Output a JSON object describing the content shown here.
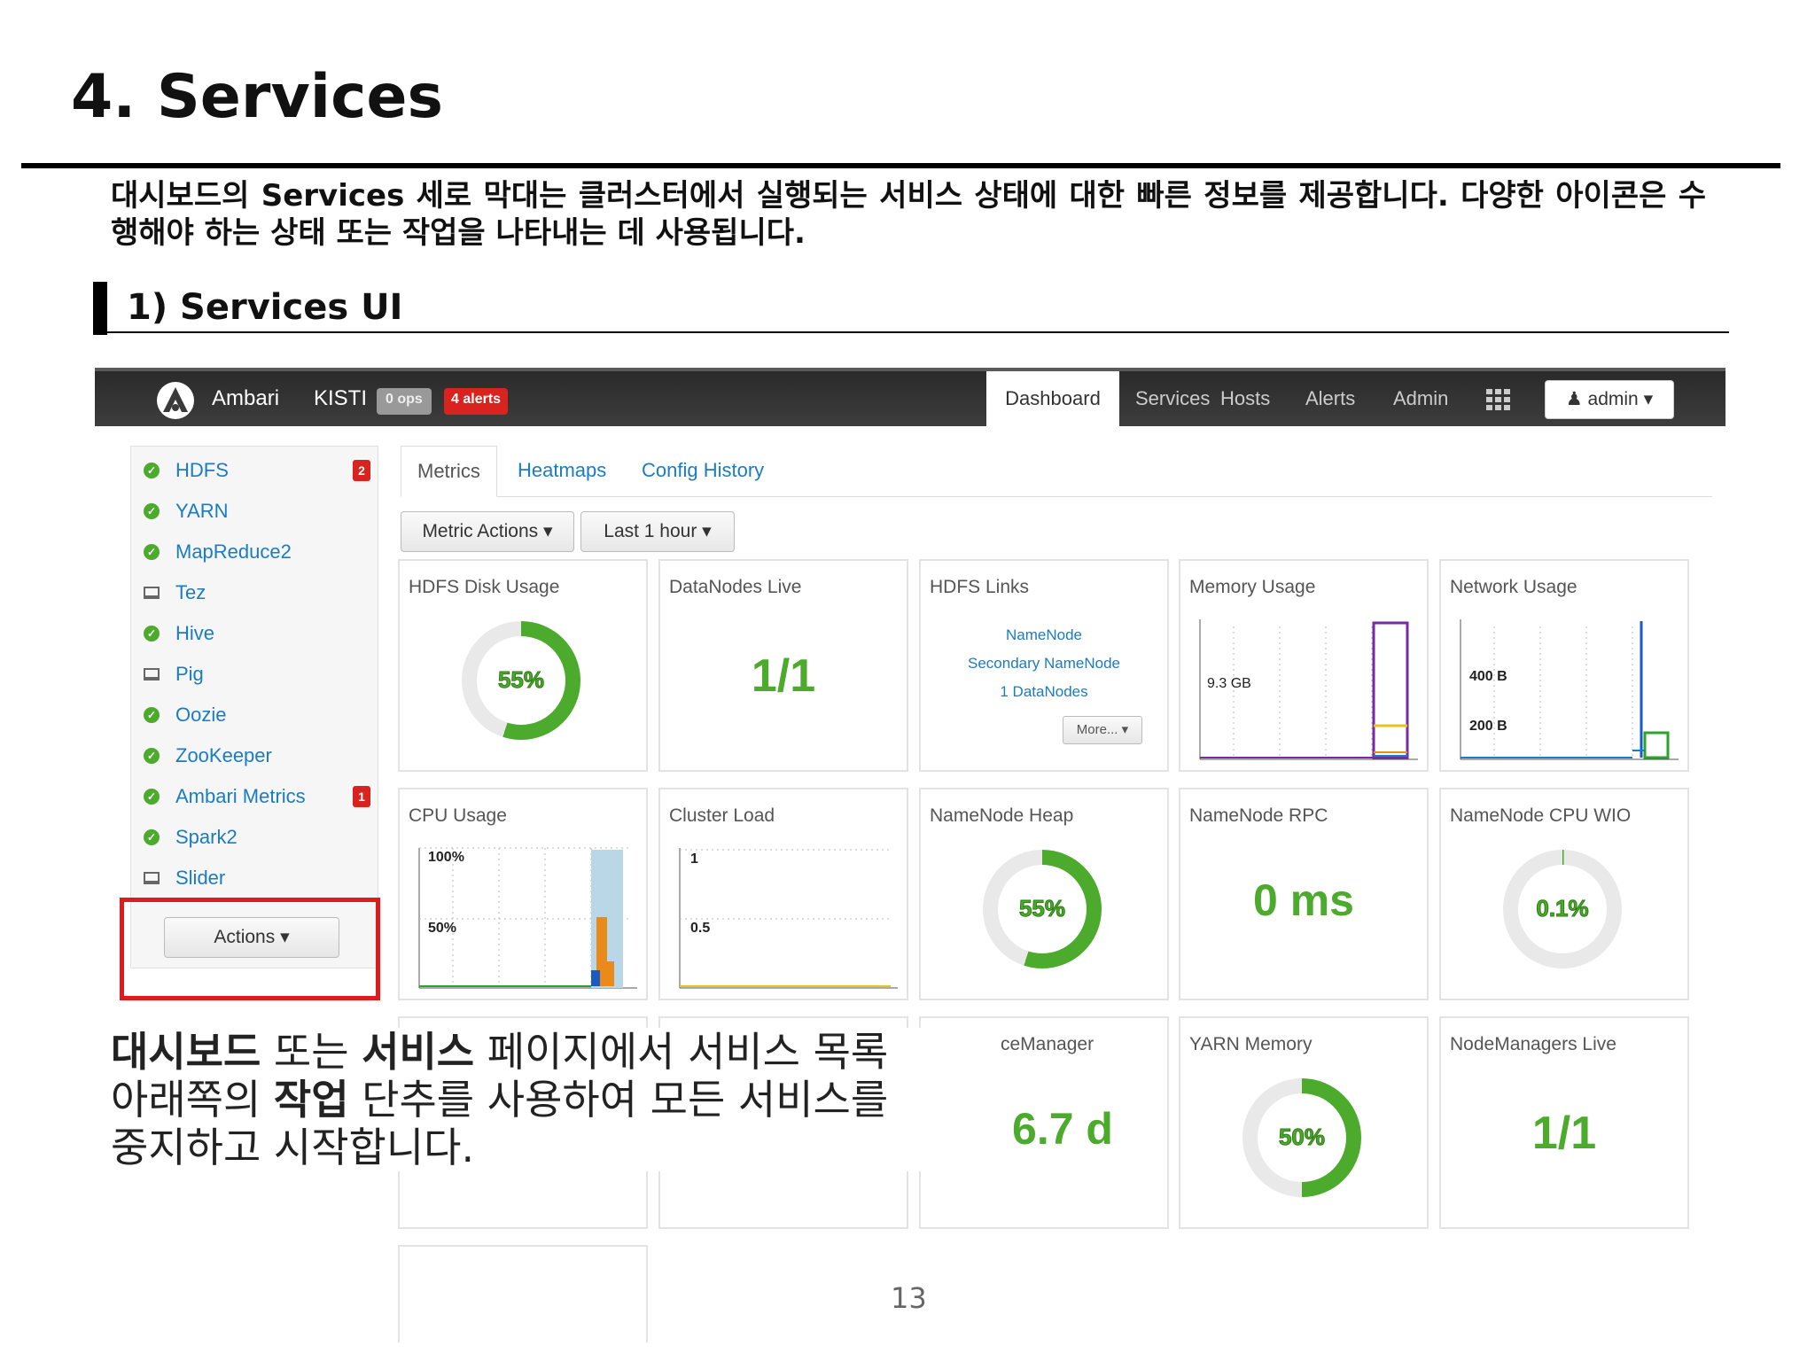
{
  "slide": {
    "title": "4. Services",
    "intro": "대시보드의 Services 세로 막대는 클러스터에서 실행되는 서비스 상태에 대한 빠른 정보를 제공합니다. 다양한 아이콘은 수행해야 하는 상태 또는 작업을 나타내는 데 사용됩니다.",
    "subtitle": "1) Services UI",
    "caption": {
      "b1": "대시보드",
      "t1": " 또는 ",
      "b2": "서비스",
      "t2": " 페이지에서 서비스 목록 아래쪽의 ",
      "b3": "작업",
      "t3": " 단추를 사용하여 모든 서비스를 중지하고 시작합니다."
    },
    "page_number": "13"
  },
  "topbar": {
    "brand": "Ambari",
    "cluster": "KISTI",
    "ops_badge": "0 ops",
    "alerts_badge": "4 alerts",
    "nav": [
      "Dashboard",
      "Services",
      "Hosts",
      "Alerts",
      "Admin"
    ],
    "grid_icon": "grid-icon",
    "user_icon": "user-icon",
    "admin": "admin"
  },
  "sidebar": {
    "services": [
      {
        "name": "HDFS",
        "icon": "check-circle-icon",
        "alerts": "2"
      },
      {
        "name": "YARN",
        "icon": "check-circle-icon"
      },
      {
        "name": "MapReduce2",
        "icon": "check-circle-icon"
      },
      {
        "name": "Tez",
        "icon": "laptop-icon"
      },
      {
        "name": "Hive",
        "icon": "check-circle-icon"
      },
      {
        "name": "Pig",
        "icon": "laptop-icon"
      },
      {
        "name": "Oozie",
        "icon": "check-circle-icon"
      },
      {
        "name": "ZooKeeper",
        "icon": "check-circle-icon"
      },
      {
        "name": "Ambari Metrics",
        "icon": "check-circle-icon",
        "alerts": "1"
      },
      {
        "name": "Spark2",
        "icon": "check-circle-icon"
      },
      {
        "name": "Slider",
        "icon": "laptop-icon"
      }
    ],
    "actions": "Actions"
  },
  "tabs": [
    "Metrics",
    "Heatmaps",
    "Config History"
  ],
  "toolbar": {
    "metric_actions": "Metric Actions",
    "time_range": "Last 1 hour"
  },
  "widgets": {
    "hdfs_disk": {
      "title": "HDFS Disk Usage",
      "value": "55%",
      "fraction": 0.55
    },
    "datanodes": {
      "title": "DataNodes Live",
      "value": "1/1"
    },
    "hdfs_links": {
      "title": "HDFS Links",
      "links": [
        "NameNode",
        "Secondary NameNode",
        "1 DataNodes"
      ],
      "more": "More..."
    },
    "memory": {
      "title": "Memory Usage",
      "label": "9.3 GB"
    },
    "network": {
      "title": "Network Usage",
      "labels": [
        "400 B",
        "200 B"
      ]
    },
    "cpu": {
      "title": "CPU Usage",
      "labels": [
        "100%",
        "50%"
      ]
    },
    "cluster_load": {
      "title": "Cluster Load",
      "labels": [
        "1",
        "0.5"
      ]
    },
    "nn_heap": {
      "title": "NameNode Heap",
      "value": "55%",
      "fraction": 0.55
    },
    "nn_rpc": {
      "title": "NameNode RPC",
      "value": "0 ms"
    },
    "nn_cpu": {
      "title": "NameNode CPU WIO",
      "value": "0.1%",
      "fraction": 0.001
    },
    "rm": {
      "title": "ceManager",
      "value": "6.7 d"
    },
    "yarn_mem": {
      "title": "YARN Memory",
      "value": "50%",
      "fraction": 0.5
    },
    "nm_live": {
      "title": "NodeManagers Live",
      "value": "1/1"
    }
  },
  "colors": {
    "green": "#4caa2c",
    "link": "#1a7cc1",
    "alert": "#d9231f",
    "highlight": "#e01b1b"
  }
}
